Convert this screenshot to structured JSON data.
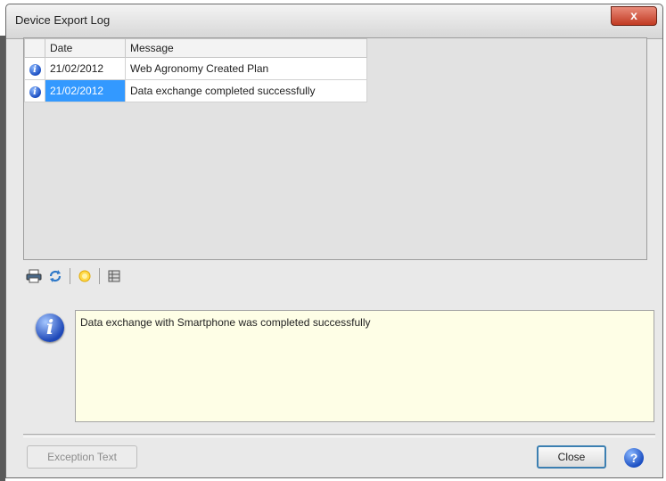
{
  "window": {
    "title": "Device Export Log",
    "close_glyph": "x"
  },
  "grid": {
    "columns": [
      "",
      "Date",
      "Message"
    ],
    "rows": [
      {
        "icon": "info-icon",
        "date": "21/02/2012",
        "message": "Web Agronomy Created Plan",
        "selected": false
      },
      {
        "icon": "info-icon",
        "date": "21/02/2012",
        "message": "Data exchange completed successfully",
        "selected": true
      }
    ]
  },
  "toolbar": {
    "icons": [
      "printer-icon",
      "refresh-icon",
      "sun-icon",
      "grid-icon"
    ]
  },
  "detail": {
    "icon": "info-large-icon",
    "text": "Data exchange with Smartphone was completed successfully"
  },
  "buttons": {
    "exception_label": "Exception Text",
    "close_label": "Close",
    "help_icon": "help-icon"
  },
  "colors": {
    "selection": "#3399ff",
    "detail_background": "#fefee6",
    "close_button_border": "#3c7fb1"
  }
}
